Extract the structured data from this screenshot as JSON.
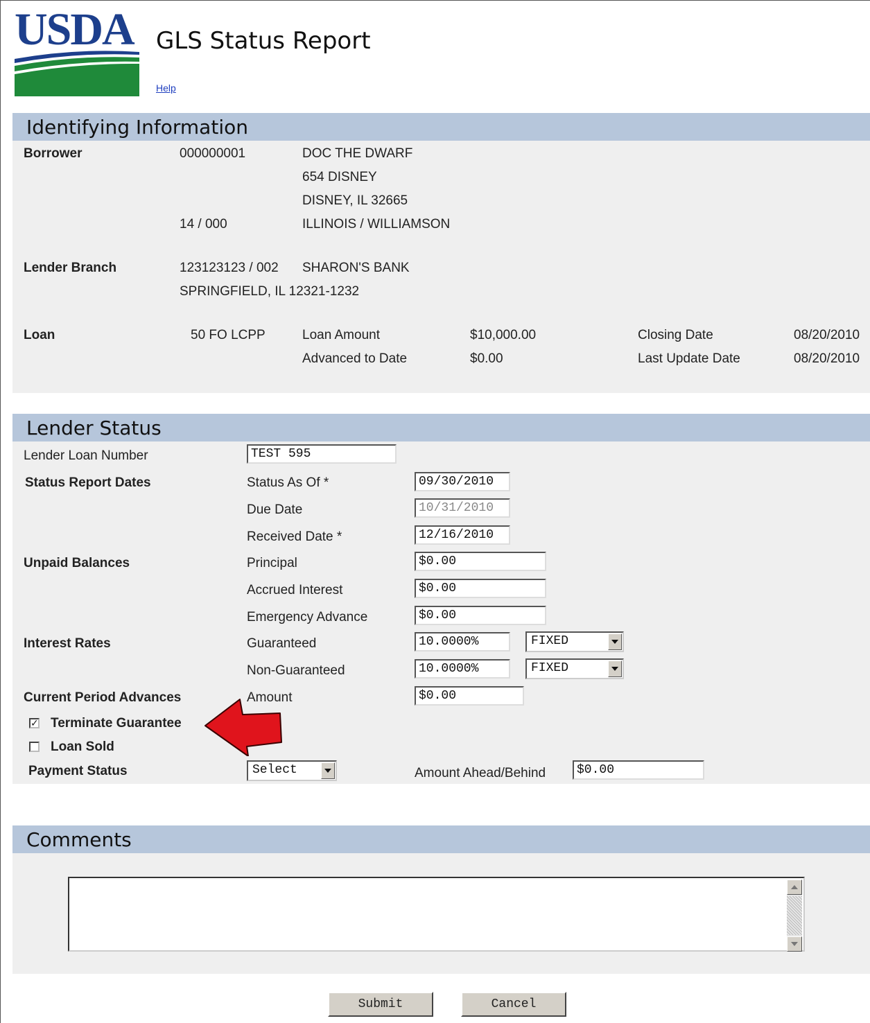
{
  "header": {
    "logo_text": "USDA",
    "title": "GLS Status Report",
    "help_label": "Help"
  },
  "identifying": {
    "section_title": "Identifying Information",
    "borrower": {
      "label": "Borrower",
      "id": "000000001",
      "name": "DOC THE DWARF",
      "address1": "654 DISNEY",
      "address2": "DISNEY, IL 32665",
      "state_county_code": "14 / 000",
      "state_county_name": "ILLINOIS / WILLIAMSON"
    },
    "lender_branch": {
      "label": "Lender Branch",
      "id": "123123123 / 002",
      "name": "SHARON'S BANK",
      "city": "SPRINGFIELD, IL 12321-1232"
    },
    "loan": {
      "label": "Loan",
      "code": "50 FO LCPP",
      "amount_label": "Loan Amount",
      "amount": "$10,000.00",
      "advanced_label": "Advanced to Date",
      "advanced": "$0.00",
      "closing_label": "Closing Date",
      "closing": "08/20/2010",
      "last_update_label": "Last Update Date",
      "last_update": "08/20/2010"
    }
  },
  "lender_status": {
    "section_title": "Lender Status",
    "lender_loan_number_label": "Lender Loan Number",
    "lender_loan_number": "TEST 595",
    "status_dates_label": "Status Report Dates",
    "status_as_of_label": "Status As Of *",
    "status_as_of": "09/30/2010",
    "due_date_label": "Due Date",
    "due_date": "10/31/2010",
    "received_label": "Received Date *",
    "received": "12/16/2010",
    "unpaid_label": "Unpaid Balances",
    "principal_label": "Principal",
    "principal": "$0.00",
    "accrued_label": "Accrued Interest",
    "accrued": "$0.00",
    "emergency_label": "Emergency Advance",
    "emergency": "$0.00",
    "rates_label": "Interest Rates",
    "guaranteed_label": "Guaranteed",
    "guaranteed_rate": "10.0000%",
    "guaranteed_type": "FIXED",
    "nonguaranteed_label": "Non-Guaranteed",
    "nonguaranteed_rate": "10.0000%",
    "nonguaranteed_type": "FIXED",
    "advances_label": "Current Period Advances",
    "amount_label": "Amount",
    "amount": "$0.00",
    "terminate_label": "Terminate Guarantee",
    "terminate_checked": true,
    "loan_sold_label": "Loan Sold",
    "loan_sold_checked": false,
    "payment_status_label": "Payment Status",
    "payment_status": "Select",
    "ahead_behind_label": "Amount Ahead/Behind",
    "ahead_behind": "$0.00"
  },
  "comments": {
    "section_title": "Comments",
    "value": ""
  },
  "actions": {
    "submit_label": "Submit",
    "cancel_label": "Cancel"
  },
  "colors": {
    "section_header": "#b6c6db",
    "panel_bg": "#efefef",
    "logo_blue": "#1d3f8c",
    "logo_green": "#1f8a3a",
    "annotation_arrow": "#e0141c"
  }
}
